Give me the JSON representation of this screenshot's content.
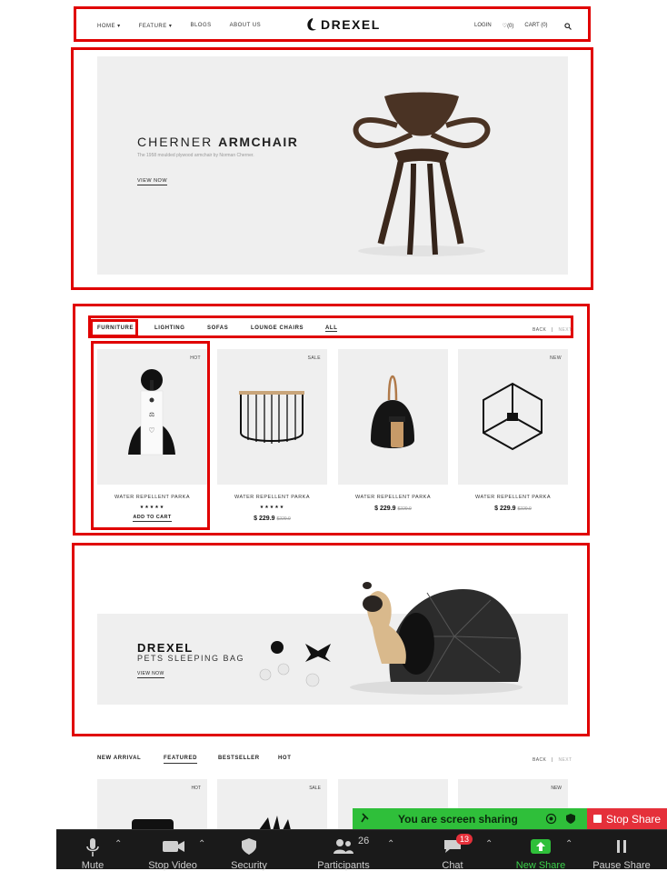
{
  "header": {
    "nav_left": [
      "HOME",
      "FEATURE",
      "BLOGS",
      "ABOUT US"
    ],
    "logo": "DREXEL",
    "login": "LOGIN",
    "wishlist": "(0)",
    "cart": "CART (0)"
  },
  "hero": {
    "title_light": "CHERNER ",
    "title_bold": "ARMCHAIR",
    "subtitle": "The 1958 moulded plywood armchair by Norman Cherner.",
    "link": "VIEW NOW"
  },
  "category_tabs": {
    "items": [
      "FURNITURE",
      "LIGHTING",
      "SOFAS",
      "LOUNGE CHAIRS",
      "ALL"
    ],
    "active": "FURNITURE",
    "back": "BACK",
    "separator": "|",
    "next": "NEXT"
  },
  "products": [
    {
      "badge": "HOT",
      "name": "WATER REPELLENT PARKA",
      "stars": "★★★★★",
      "action": "ADD TO CART"
    },
    {
      "badge": "SALE",
      "name": "WATER REPELLENT PARKA",
      "stars": "★★★★★",
      "price": "$ 229.9",
      "old_price": "$229.9"
    },
    {
      "badge": "",
      "name": "WATER REPELLENT PARKA",
      "price": "$ 229.9",
      "old_price": "$229.9"
    },
    {
      "badge": "NEW",
      "name": "WATER REPELLENT PARKA",
      "price": "$ 229.9",
      "old_price": "$229.9"
    }
  ],
  "banner": {
    "title": "DREXEL",
    "subtitle": "PETS SLEEPING BAG",
    "link": "VIEW NOW"
  },
  "bottom_tabs": {
    "items": [
      "NEW ARRIVAL",
      "FEATURED",
      "BESTSELLER",
      "HOT"
    ],
    "active": "FEATURED",
    "back": "BACK",
    "separator": "|",
    "next": "NEXT"
  },
  "bottom_badges": [
    "HOT",
    "SALE",
    "NEW"
  ],
  "zoom": {
    "share_text": "You are screen sharing",
    "stop_share": "Stop Share",
    "mute": "Mute",
    "stop_video": "Stop Video",
    "security": "Security",
    "participants": "Participants",
    "participants_count": "26",
    "chat": "Chat",
    "chat_count": "13",
    "new_share": "New Share",
    "pause_share": "Pause Share"
  },
  "colors": {
    "highlight": "#e00000",
    "panel_bg": "#efefef",
    "share_green": "#2fbf3a",
    "stop_red": "#e5303a",
    "zoom_bar": "#1a1a1a"
  }
}
